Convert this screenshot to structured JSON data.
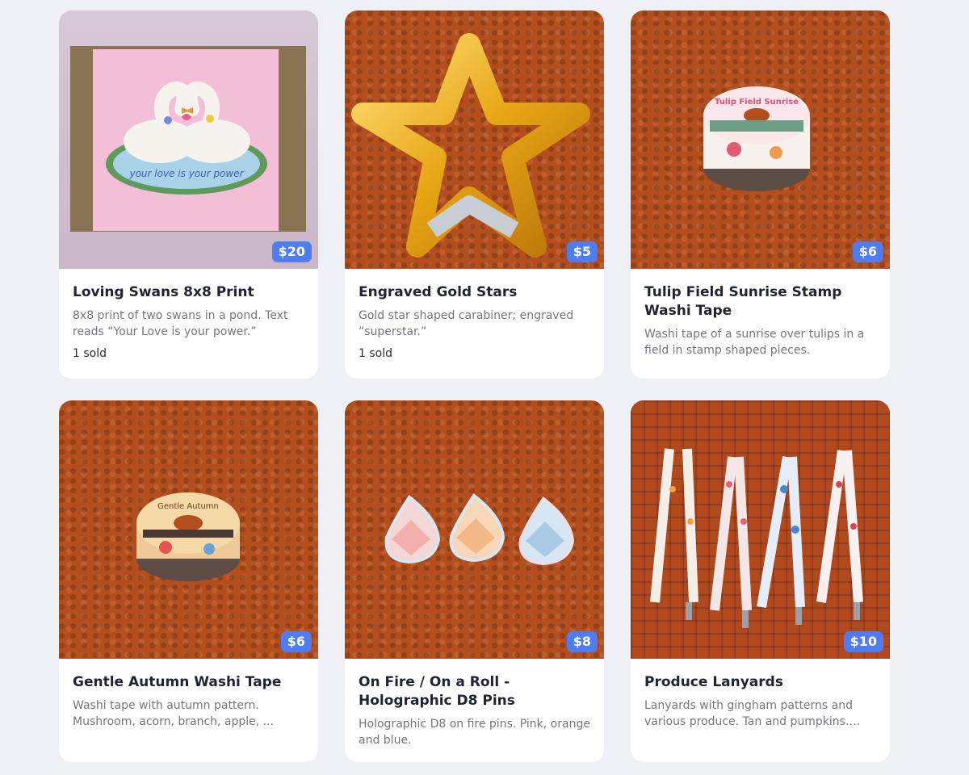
{
  "products": [
    {
      "title": "Loving Swans 8x8 Print",
      "description": "8x8 print of two swans in a pond. Text reads “Your Love is your power.”",
      "price": "$20",
      "sold": "1 sold",
      "image_text": "your love is your power"
    },
    {
      "title": "Engraved Gold Stars",
      "description": "Gold star shaped carabiner; engraved “superstar.”",
      "price": "$5",
      "sold": "1 sold"
    },
    {
      "title": "Tulip Field Sunrise Stamp Washi Tape",
      "description": "Washi tape of a sunrise over tulips in a field in stamp shaped pieces.",
      "price": "$6",
      "image_text": "Tulip Field Sunrise"
    },
    {
      "title": "Gentle Autumn Washi Tape",
      "description": "Washi tape with autumn pattern. Mushroom, acorn, branch, apple, ...",
      "price": "$6",
      "image_text": "Gentle Autumn"
    },
    {
      "title": "On Fire / On a Roll - Holographic D8 Pins",
      "description": "Holographic D8 on fire pins. Pink, orange and blue.",
      "price": "$8"
    },
    {
      "title": "Produce Lanyards",
      "description": "Lanyards with gingham patterns and various produce. Tan and pumpkins. Re...",
      "price": "$10"
    }
  ],
  "colors": {
    "page_background": "#eef0f6",
    "price_badge": "#4f7cf0",
    "knit_orange": "#b34f1f"
  }
}
